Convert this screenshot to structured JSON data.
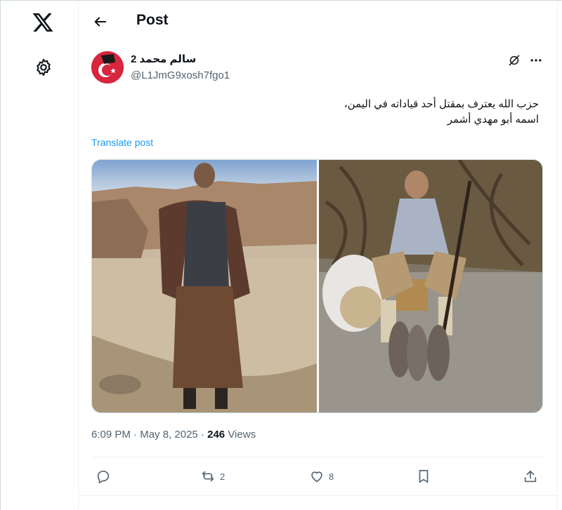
{
  "nav": {
    "logo_icon": "x-logo-icon",
    "settings_icon": "gear-icon"
  },
  "header": {
    "title": "Post"
  },
  "author": {
    "display_name": "سالم محمد 2",
    "handle": "@L1JmG9xosh7fgo1"
  },
  "post": {
    "text": "حزب الله يعترف بمقتل أحد قياداته في اليمن،\nاسمه أبو مهدي أشمر",
    "translate_label": "Translate post",
    "time": "6:09 PM",
    "date": "May 8, 2025",
    "views_count": "246",
    "views_label": "Views"
  },
  "actions": {
    "reply_count": "",
    "repost_count": "2",
    "like_count": "8"
  },
  "colors": {
    "link": "#1d9bf0",
    "muted": "#536471",
    "text": "#0f1419",
    "border": "#eff3f4"
  }
}
